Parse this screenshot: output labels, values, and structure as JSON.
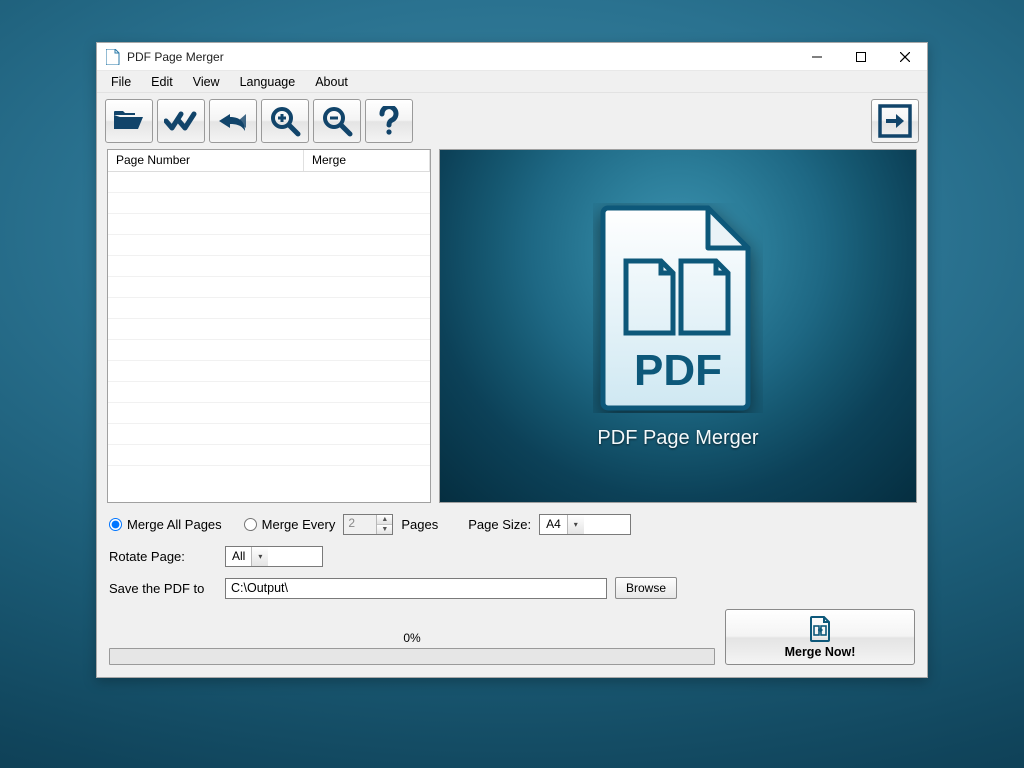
{
  "title": "PDF Page Merger",
  "menus": {
    "file": "File",
    "edit": "Edit",
    "view": "View",
    "language": "Language",
    "about": "About"
  },
  "toolbar": {
    "open": "open-folder-icon",
    "select_all": "select-all-icon",
    "undo": "undo-icon",
    "zoom_in": "zoom-in-icon",
    "zoom_out": "zoom-out-icon",
    "help": "help-icon",
    "export": "export-icon"
  },
  "list": {
    "col_page_number": "Page Number",
    "col_merge": "Merge",
    "rows": []
  },
  "preview": {
    "app_name": "PDF Page Merger",
    "logo_text": "PDF"
  },
  "options": {
    "merge_all_label": "Merge All Pages",
    "merge_every_label": "Merge Every",
    "merge_every_value": "2",
    "pages_suffix": "Pages",
    "page_size_label": "Page Size:",
    "page_size_value": "A4",
    "rotate_label": "Rotate Page:",
    "rotate_value": "All",
    "save_label": "Save the PDF to",
    "save_path": "C:\\Output\\",
    "browse_label": "Browse",
    "selected_radio": "merge_all"
  },
  "progress": {
    "text": "0%"
  },
  "merge_button": {
    "label": "Merge Now!"
  }
}
